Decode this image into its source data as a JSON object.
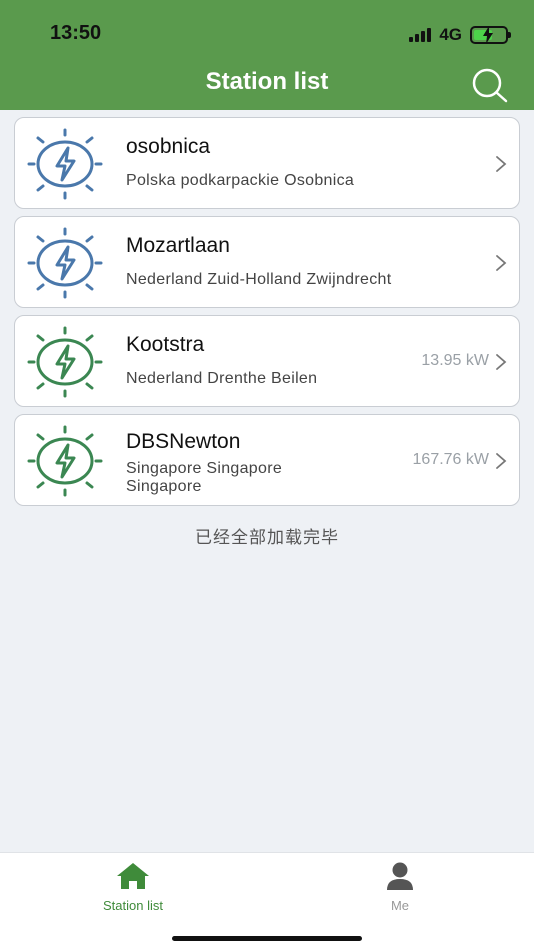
{
  "status_bar": {
    "time": "13:50",
    "network": "4G"
  },
  "header": {
    "title": "Station list"
  },
  "colors": {
    "accent": "#5a9a4d",
    "icon_blue": "#4a78ab",
    "icon_green": "#3b8752"
  },
  "stations": [
    {
      "name": "osobnica",
      "address": "Polska podkarpackie  Osobnica",
      "power": "",
      "icon": "solar-bolt-blue-icon"
    },
    {
      "name": "Mozartlaan",
      "address": "Nederland Zuid-Holland Zwijndrecht",
      "power": "",
      "icon": "solar-bolt-blue-icon"
    },
    {
      "name": "Kootstra",
      "address": "Nederland Drenthe Beilen",
      "power": "13.95 kW",
      "icon": "solar-bolt-green-icon"
    },
    {
      "name": "DBSNewton",
      "address": "Singapore Singapore Singapore",
      "power": "167.76 kW",
      "icon": "solar-bolt-green-icon"
    }
  ],
  "list_end_text": "已经全部加载完毕",
  "tabbar": {
    "items": [
      {
        "label": "Station list",
        "icon": "home-icon"
      },
      {
        "label": "Me",
        "icon": "person-icon"
      }
    ]
  }
}
